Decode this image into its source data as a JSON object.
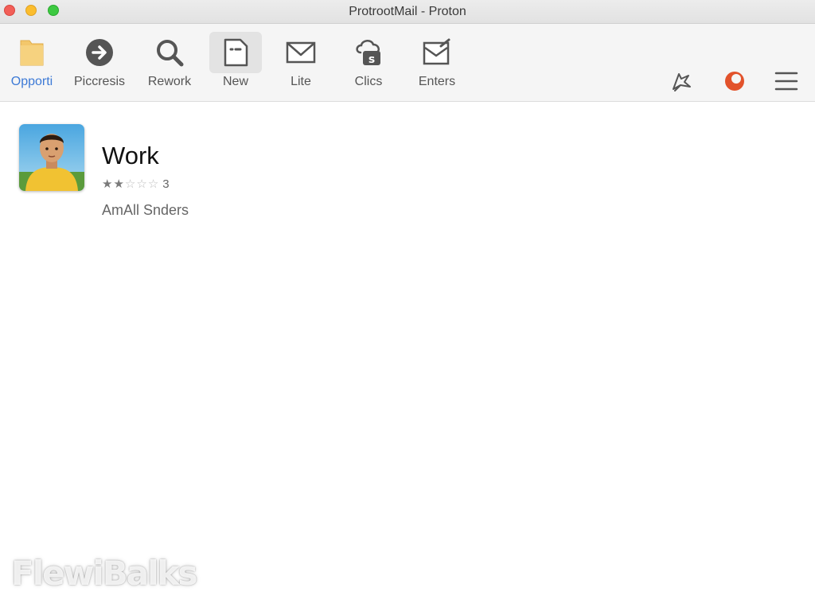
{
  "window": {
    "title": "ProtrootMail - Proton"
  },
  "toolbar": {
    "items": [
      {
        "label": "Opporti",
        "icon": "folder-icon"
      },
      {
        "label": "Piccresis",
        "icon": "circle-arrow-right-icon"
      },
      {
        "label": "Rework",
        "icon": "search-icon"
      },
      {
        "label": "New",
        "icon": "new-document-icon"
      },
      {
        "label": "Lite",
        "icon": "mail-icon"
      },
      {
        "label": "Clics",
        "icon": "cloud-lock-icon"
      },
      {
        "label": "Enters",
        "icon": "mail-edit-icon"
      }
    ],
    "selected_index": 0,
    "active_index": 3,
    "right_icons": [
      "send-icon",
      "proton-logo-icon",
      "menu-icon"
    ]
  },
  "list": {
    "items": [
      {
        "title": "Work",
        "rating": 2,
        "rating_max": 5,
        "rating_count": "3",
        "subtitle": "AmAll Snders",
        "avatar": "person-avatar-icon"
      }
    ]
  },
  "watermark": "FlewiBalks",
  "colors": {
    "accent": "#3d7ad6",
    "brand": "#e2522b",
    "folder": "#f3c76b"
  }
}
